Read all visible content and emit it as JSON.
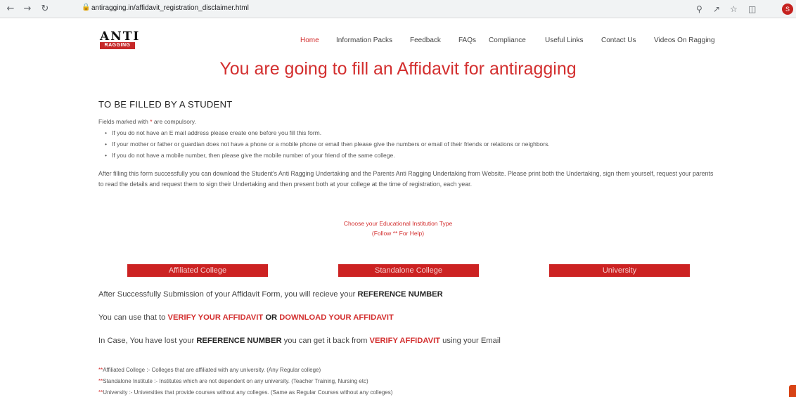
{
  "browser": {
    "url": "antiragging.in/affidavit_registration_disclaimer.html",
    "profile_initial": "S"
  },
  "site": {
    "logo_top": "ANTI",
    "logo_bottom": "RAGGING"
  },
  "nav": [
    "Home",
    "Information Packs",
    "Feedback",
    "FAQs",
    "Compliance",
    "Useful Links",
    "Contact Us",
    "Videos On Ragging"
  ],
  "page": {
    "title": "You are going to fill an Affidavit for antiragging",
    "subtitle": "TO BE FILLED BY A STUDENT",
    "note_before": "Fields marked with ",
    "note_star": "*",
    "note_after": " are compulsory.",
    "bullets": [
      "If you do not have an E mail address please create one before you fill this form.",
      "If your mother or father or guardian does not have a phone or a mobile phone or email then please give the numbers or email of their friends or relations or neighbors.",
      "If you do not have a mobile number, then please give the mobile number of your friend of the same college."
    ],
    "paragraph": "After filling this form successfully you can download the Student's Anti Ragging Undertaking and the Parents Anti Ragging Undertaking from Website. Please print both the Undertaking, sign them yourself, request your parents to read the details and request them to sign their Undertaking and then present both at your college at the time of registration, each year.",
    "choose_line1": "Choose your Educational Institution Type",
    "choose_line2": "(Follow ** For Help)",
    "buttons": [
      "Affiliated College",
      "Standalone College",
      "University"
    ],
    "line1_text": "After Successfully Submission of your Affidavit Form, you will recieve your ",
    "line1_bold": "REFERENCE NUMBER",
    "line2_text": "You can use that to ",
    "line2_red1": "VERIFY YOUR AFFIDAVIT",
    "line2_or": " OR ",
    "line2_red2": "DOWNLOAD YOUR AFFIDAVIT",
    "line3_a": "In Case, You have lost your ",
    "line3_bold": "REFERENCE NUMBER",
    "line3_b": " you can get it back from ",
    "line3_red": "VERIFY AFFIDAVIT",
    "line3_c": " using your Email",
    "footnotes": [
      {
        "prefix": "**",
        "text": "Affiliated College :- Colleges that are affiliated with any university. (Any Regular college)"
      },
      {
        "prefix": "**",
        "text": "Standalone Institute :- Institutes which are not dependent on any university. (Teacher Training, Nursing etc)"
      },
      {
        "prefix": "**",
        "text": "University :- Universities that provide courses without any colleges. (Same as Regular Courses without any colleges)"
      }
    ]
  },
  "colors": {
    "accent": "#d32f2f",
    "button": "#cc2222"
  }
}
